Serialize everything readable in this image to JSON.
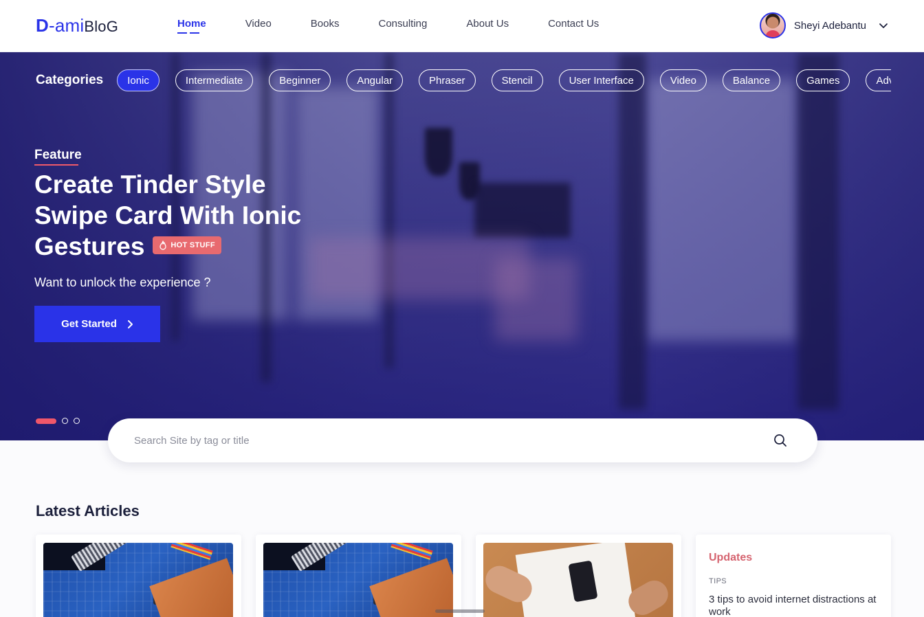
{
  "header": {
    "logo": {
      "part1": "D",
      "part2": "-ami",
      "part3": "BloG"
    },
    "nav": [
      {
        "label": "Home",
        "active": true
      },
      {
        "label": "Video"
      },
      {
        "label": "Books"
      },
      {
        "label": "Consulting"
      },
      {
        "label": "About Us"
      },
      {
        "label": "Contact Us"
      }
    ],
    "user": {
      "name": "Sheyi Adebantu"
    }
  },
  "hero": {
    "categories_label": "Categories",
    "categories": [
      "Ionic",
      "Intermediate",
      "Beginner",
      "Angular",
      "Phraser",
      "Stencil",
      "User Interface",
      "Video",
      "Balance",
      "Games",
      "Advanced"
    ],
    "active_category": "Ionic",
    "feature_label": "Feature",
    "title": "Create Tinder Style Swipe Card With Ionic Gestures",
    "badge": "HOT STUFF",
    "subtitle": "Want to unlock the experience ?",
    "cta_label": "Get Started",
    "carousel": {
      "total": 3,
      "active": 1
    }
  },
  "search": {
    "placeholder": "Search Site by tag or title",
    "value": ""
  },
  "latest": {
    "title": "Latest Articles",
    "updates": {
      "title": "Updates",
      "tag": "TIPS",
      "text": "3 tips to avoid internet distractions at work"
    }
  },
  "colors": {
    "primary": "#2a33e8",
    "accent": "#f0576a",
    "badge": "#e86a6f",
    "updates_title": "#d5636f"
  },
  "icons": {
    "user_menu": "chevron-down-icon",
    "cta": "chevron-right-icon",
    "search": "search-icon",
    "badge": "flame-icon"
  }
}
